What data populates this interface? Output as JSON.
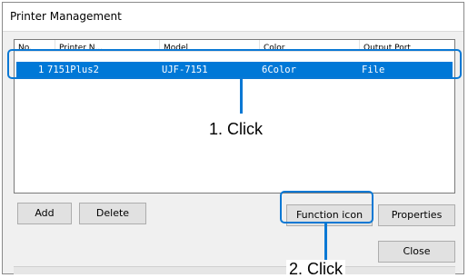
{
  "window": {
    "title": "Printer Management"
  },
  "printer_list": {
    "columns": [
      "No.",
      "Printer N...",
      "Model",
      "Color",
      "Output Port"
    ],
    "rows": [
      {
        "no": "1",
        "printer_name": "7151Plus2",
        "model": "UJF-7151",
        "color": "6Color",
        "output_port": "File",
        "selected": true
      }
    ]
  },
  "buttons": {
    "add": "Add",
    "delete": "Delete",
    "function_icon": "Function icon",
    "properties": "Properties",
    "close": "Close"
  },
  "annotations": {
    "step1": "1. Click",
    "step2": "2. Click",
    "highlight_color": "#0a78d4"
  },
  "colors": {
    "selection": "#0078d7",
    "dialog_bg": "#f0f0f0"
  }
}
